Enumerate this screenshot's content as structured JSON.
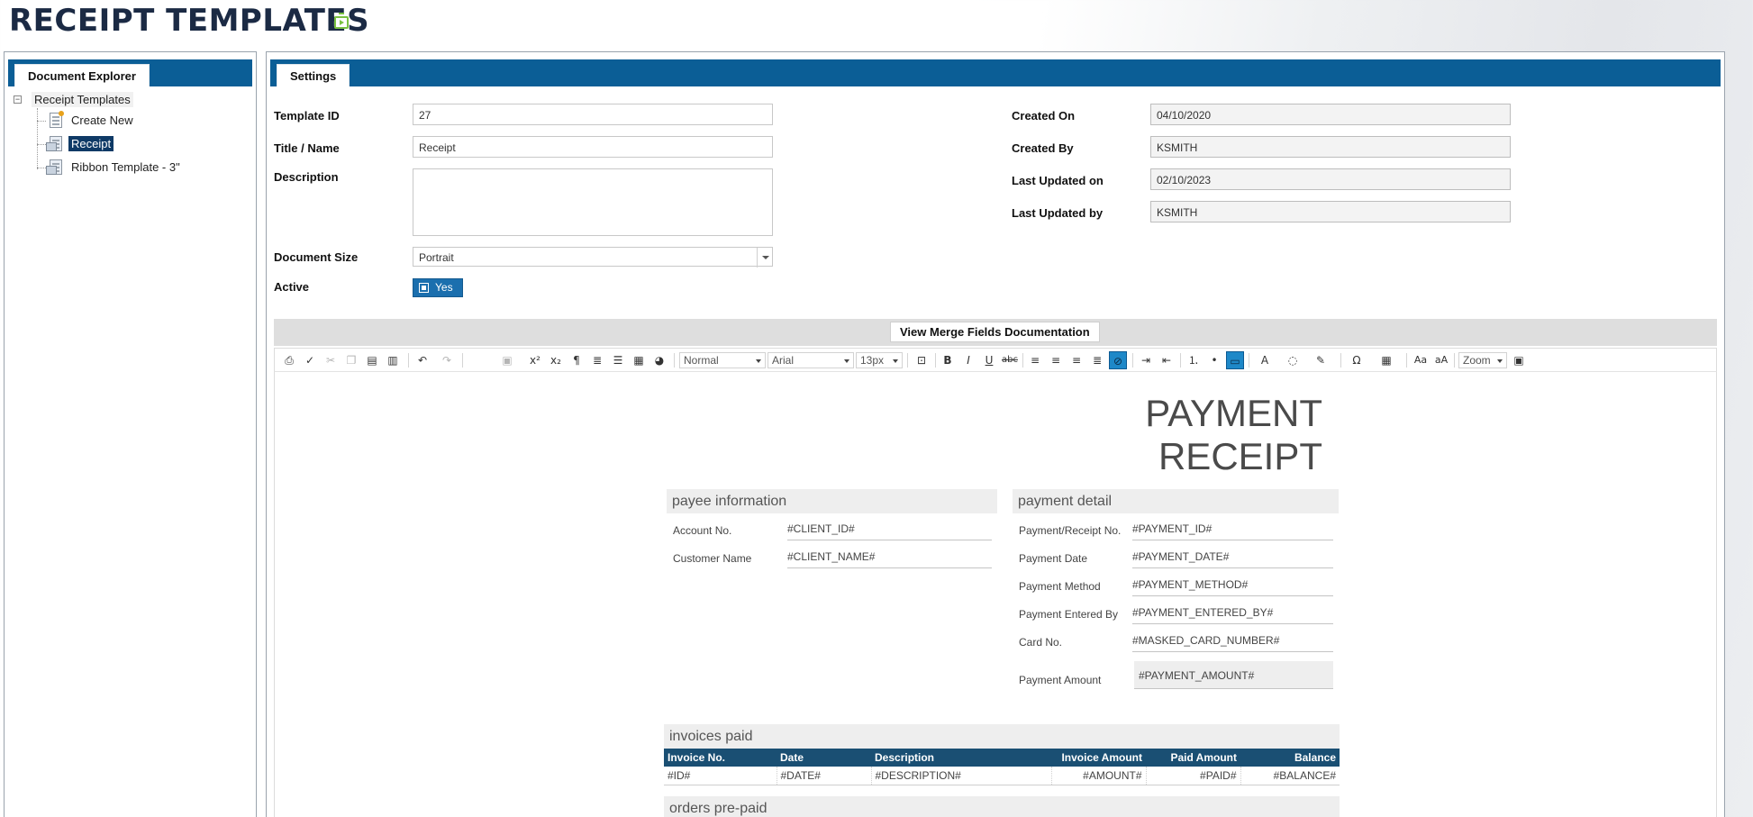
{
  "page": {
    "title": "RECEIPT TEMPLATES"
  },
  "explorer": {
    "tab": "Document Explorer",
    "root": "Receipt Templates",
    "items": [
      {
        "label": "Create New",
        "icon": "new-document-icon"
      },
      {
        "label": "Receipt",
        "icon": "template-document-icon",
        "selected": true
      },
      {
        "label": "Ribbon Template - 3\"",
        "icon": "template-document-icon"
      }
    ]
  },
  "settings": {
    "tab": "Settings",
    "template_id_label": "Template ID",
    "template_id": "27",
    "title_label": "Title / Name",
    "title": "Receipt",
    "description_label": "Description",
    "description": "",
    "doc_size_label": "Document Size",
    "doc_size": "Portrait",
    "active_label": "Active",
    "active": "Yes",
    "created_on_label": "Created On",
    "created_on": "04/10/2020",
    "created_by_label": "Created By",
    "created_by": "KSMITH",
    "updated_on_label": "Last Updated on",
    "updated_on": "02/10/2023",
    "updated_by_label": "Last Updated by",
    "updated_by": "KSMITH"
  },
  "merge": {
    "button": "View Merge Fields Documentation"
  },
  "toolbar": {
    "format": "Normal",
    "font": "Arial",
    "size": "13px",
    "zoom": "Zoom",
    "active_color": "#1e88c8"
  },
  "receipt": {
    "title_line1": "PAYMENT",
    "title_line2": "RECEIPT",
    "payee_head": "payee information",
    "payee": [
      {
        "label": "Account No.",
        "value": "#CLIENT_ID#"
      },
      {
        "label": "Customer Name",
        "value": "#CLIENT_NAME#"
      }
    ],
    "payment_head": "payment detail",
    "payment": [
      {
        "label": "Payment/Receipt No.",
        "value": "#PAYMENT_ID#"
      },
      {
        "label": "Payment Date",
        "value": "#PAYMENT_DATE#"
      },
      {
        "label": "Payment Method",
        "value": "#PAYMENT_METHOD#"
      },
      {
        "label": "Payment Entered By",
        "value": "#PAYMENT_ENTERED_BY#"
      },
      {
        "label": "Card No.",
        "value": "#MASKED_CARD_NUMBER#"
      }
    ],
    "amount_label": "Payment Amount",
    "amount_value": "#PAYMENT_AMOUNT#",
    "invoices_head": "invoices paid",
    "invoice_columns": [
      "Invoice No.",
      "Date",
      "Description",
      "Invoice Amount",
      "Paid Amount",
      "Balance"
    ],
    "invoice_row": [
      "#ID#",
      "#DATE#",
      "#DESCRIPTION#",
      "#AMOUNT#",
      "#PAID#",
      "#BALANCE#"
    ],
    "orders_head": "orders pre-paid"
  }
}
